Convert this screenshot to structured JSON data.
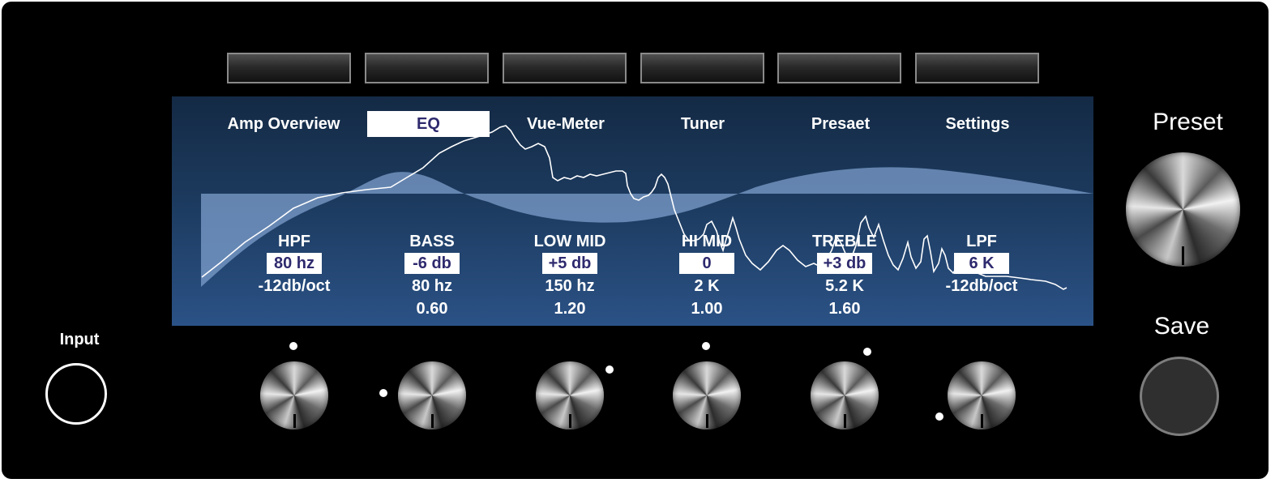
{
  "tabs": [
    "Amp Overview",
    "EQ",
    "Vue-Meter",
    "Tuner",
    "Presaet",
    "Settings"
  ],
  "active_tab": "EQ",
  "bands": [
    {
      "name": "HPF",
      "value": "80 hz",
      "line3": "-12db/oct",
      "line4": ""
    },
    {
      "name": "BASS",
      "value": "-6 db",
      "line3": "80 hz",
      "line4": "0.60"
    },
    {
      "name": "LOW MID",
      "value": "+5 db",
      "line3": "150 hz",
      "line4": "1.20"
    },
    {
      "name": "HI MID",
      "value": "0",
      "line3": "2 K",
      "line4": "1.00"
    },
    {
      "name": "TREBLE",
      "value": "+3 db",
      "line3": "5.2 K",
      "line4": "1.60"
    },
    {
      "name": "LPF",
      "value": "6 K",
      "line3": "-12db/oct",
      "line4": ""
    }
  ],
  "labels": {
    "input": "Input",
    "preset": "Preset",
    "save": "Save"
  },
  "colors": {
    "screen_top": "#142a45",
    "screen_bottom": "#2b5286",
    "highlight_text": "#2e2a6e",
    "eq_fill": "#7d9fcc"
  },
  "icons": [
    "knob-icon",
    "input-jack-icon"
  ]
}
